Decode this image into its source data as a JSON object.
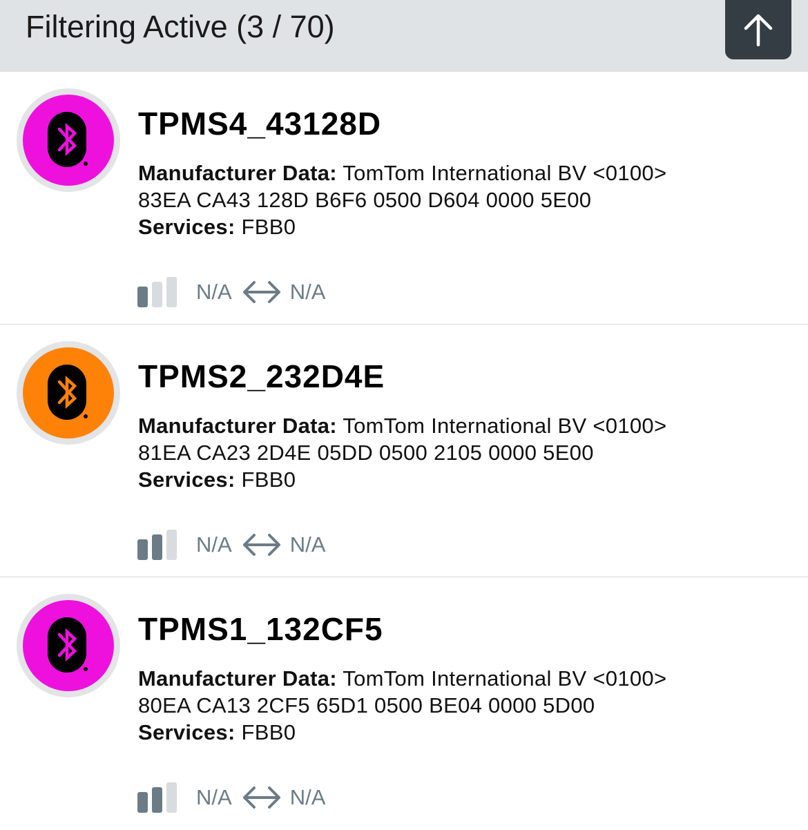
{
  "header": {
    "title": "Filtering Active (3 / 70)",
    "scroll_top_icon": "arrow-up-icon"
  },
  "colors": {
    "header_bg": "#dfe3e6",
    "button_bg": "#343c44",
    "magenta": "#ee11dd",
    "orange": "#fe8208",
    "stat_gray": "#6c7c86"
  },
  "devices": [
    {
      "name": "TPMS4_43128D",
      "color": "#ee11dd",
      "icon": "bluetooth-icon",
      "manufacturer_label": "Manufacturer Data:",
      "manufacturer_value": "TomTom International BV <0100>",
      "data_hex": "83EA CA43 128D B6F6 0500 D604 0000 5E00",
      "services_label": "Services:",
      "services_value": "FBB0",
      "signal_level": 1,
      "rssi": "N/A",
      "interval": "N/A"
    },
    {
      "name": "TPMS2_232D4E",
      "color": "#fe8208",
      "icon": "bluetooth-icon",
      "manufacturer_label": "Manufacturer Data:",
      "manufacturer_value": "TomTom International BV <0100>",
      "data_hex": "81EA CA23 2D4E 05DD 0500 2105 0000 5E00",
      "services_label": "Services:",
      "services_value": "FBB0",
      "signal_level": 2,
      "rssi": "N/A",
      "interval": "N/A"
    },
    {
      "name": "TPMS1_132CF5",
      "color": "#ee11dd",
      "icon": "bluetooth-icon",
      "manufacturer_label": "Manufacturer Data:",
      "manufacturer_value": "TomTom International BV <0100>",
      "data_hex": "80EA CA13 2CF5 65D1 0500 BE04 0000 5D00",
      "services_label": "Services:",
      "services_value": "FBB0",
      "signal_level": 2,
      "rssi": "N/A",
      "interval": "N/A"
    }
  ]
}
